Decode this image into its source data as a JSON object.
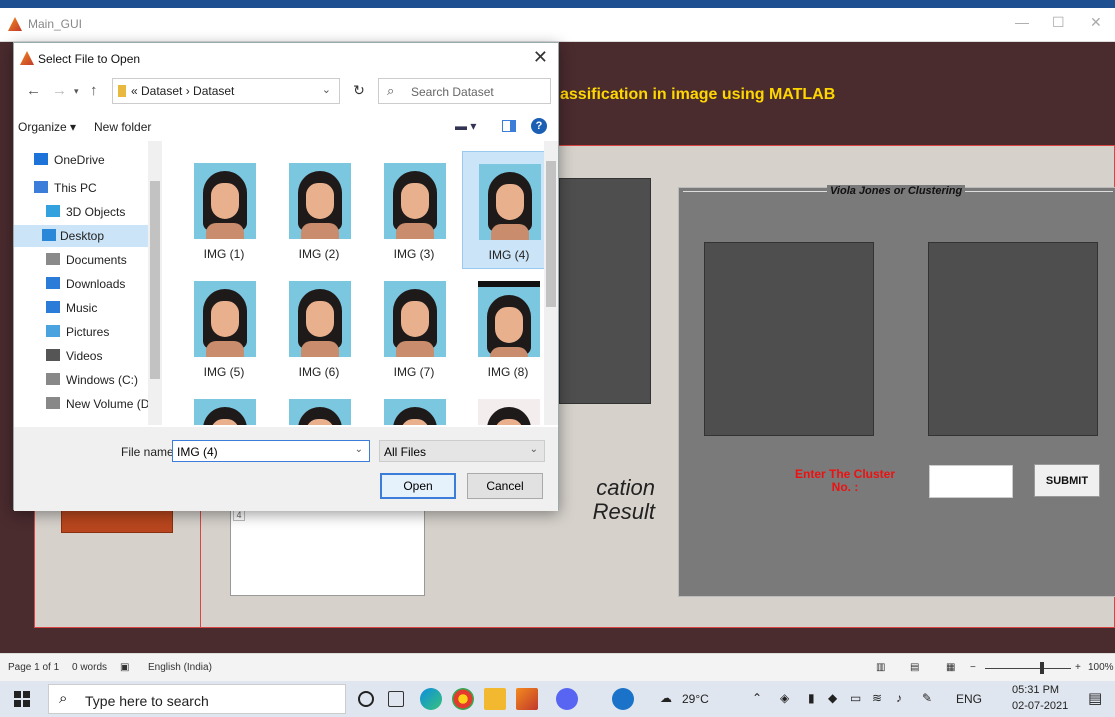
{
  "gui": {
    "window_title": "Main_GUI",
    "heading": "assification in image using MATLAB",
    "result_text_line1": "cation",
    "result_text_line2": "Result",
    "vj_panel_title": "Viola Jones or  Clustering",
    "cluster_label": "Enter The Cluster No. :",
    "submit_label": "SUBMIT",
    "result_box_marker": "4"
  },
  "dialog": {
    "title": "Select File to Open",
    "address_crumb": "«  Dataset  ›  Dataset",
    "search_placeholder": "Search Dataset",
    "organize_label": "Organize ▾",
    "new_folder_label": "New folder",
    "nav_items": [
      {
        "label": "OneDrive",
        "icon": "cloud-icon",
        "color": "#1e73d8"
      },
      {
        "label": "This PC",
        "icon": "computer-icon",
        "color": "#3b7dd8"
      },
      {
        "label": "3D Objects",
        "icon": "cube-icon",
        "color": "#33a1de"
      },
      {
        "label": "Desktop",
        "icon": "desktop-icon",
        "color": "#2b88d8"
      },
      {
        "label": "Documents",
        "icon": "document-icon",
        "color": "#8a8a8a"
      },
      {
        "label": "Downloads",
        "icon": "download-icon",
        "color": "#2b7bd8"
      },
      {
        "label": "Music",
        "icon": "music-icon",
        "color": "#2b7bd8"
      },
      {
        "label": "Pictures",
        "icon": "picture-icon",
        "color": "#4aa3df"
      },
      {
        "label": "Videos",
        "icon": "video-icon",
        "color": "#555"
      },
      {
        "label": "Windows (C:)",
        "icon": "drive-icon",
        "color": "#888"
      },
      {
        "label": "New Volume (D:)",
        "icon": "drive-icon",
        "color": "#888"
      }
    ],
    "selected_nav_index": 3,
    "files": [
      {
        "label": "IMG (1)"
      },
      {
        "label": "IMG (2)"
      },
      {
        "label": "IMG (3)"
      },
      {
        "label": "IMG (4)"
      },
      {
        "label": "IMG (5)"
      },
      {
        "label": "IMG (6)"
      },
      {
        "label": "IMG (7)"
      },
      {
        "label": "IMG (8)"
      },
      {
        "label": ""
      },
      {
        "label": ""
      },
      {
        "label": ""
      },
      {
        "label": ""
      }
    ],
    "selected_file_index": 3,
    "file_name_label": "File name:",
    "file_name_value": "IMG (4)",
    "filter_value": "All Files",
    "open_label": "Open",
    "cancel_label": "Cancel"
  },
  "statusbar": {
    "page": "Page 1 of 1",
    "words": "0 words",
    "language": "English (India)",
    "zoom": "100%"
  },
  "taskbar": {
    "search_placeholder": "Type here to search",
    "weather": "29°C",
    "lang": "ENG",
    "time": "05:31 PM",
    "date": "02-07-2021",
    "notification_count": "1"
  }
}
